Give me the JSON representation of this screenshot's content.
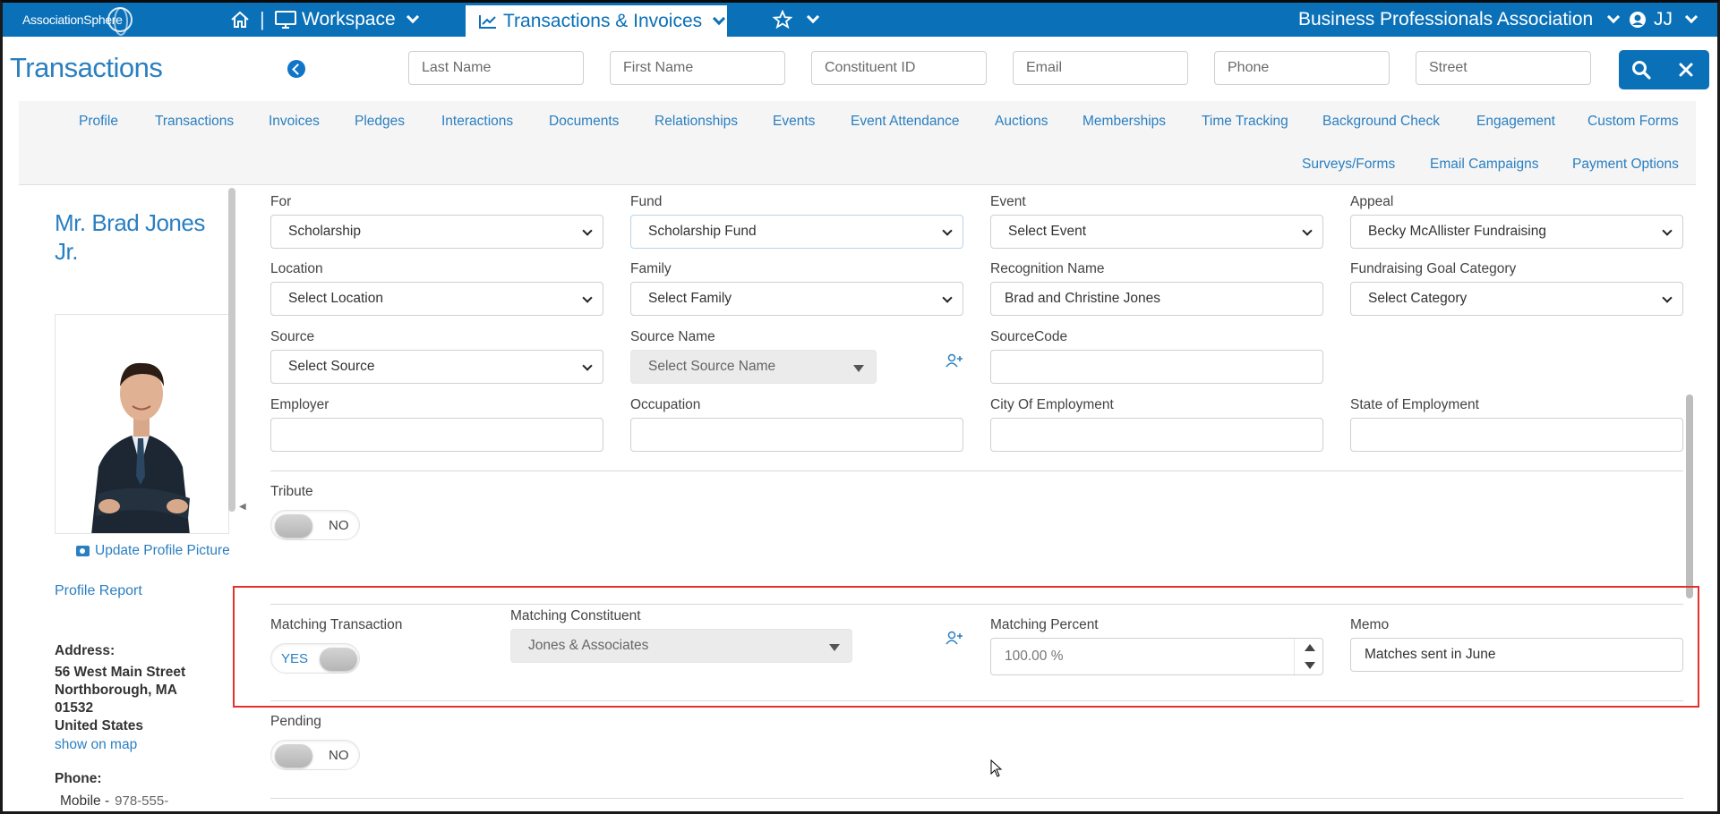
{
  "topbar": {
    "logo": "AssociationSphere",
    "separator": "|",
    "workspace": "Workspace",
    "active_tab": "Transactions & Invoices",
    "org": "Business Professionals Association",
    "user": "JJ",
    "colors": {
      "bar": "#0a70b8",
      "accent": "#2a7fc1",
      "highlight": "#e1322f"
    }
  },
  "header": {
    "title": "Transactions",
    "search": {
      "last_name": "Last Name",
      "first_name": "First Name",
      "constituent_id": "Constituent ID",
      "email": "Email",
      "phone": "Phone",
      "street": "Street"
    }
  },
  "nav": {
    "row1": [
      "Profile",
      "Transactions",
      "Invoices",
      "Pledges",
      "Interactions",
      "Documents",
      "Relationships",
      "Events",
      "Event Attendance",
      "Auctions",
      "Memberships",
      "Time Tracking",
      "Background Check",
      "Engagement",
      "Custom Forms"
    ],
    "row2": [
      "Surveys/Forms",
      "Email Campaigns",
      "Payment Options"
    ]
  },
  "profile": {
    "name": "Mr. Brad Jones Jr.",
    "update_picture": "Update Profile Picture",
    "profile_report": "Profile Report",
    "address_label": "Address:",
    "address_lines": [
      "56 West Main Street",
      "Northborough, MA",
      "01532",
      "United States"
    ],
    "show_on_map": "show on map",
    "phone_label": "Phone:",
    "mobile_label": "Mobile -",
    "mobile_number": "978-555-"
  },
  "form": {
    "for": {
      "label": "For",
      "value": "Scholarship"
    },
    "fund": {
      "label": "Fund",
      "value": "Scholarship Fund"
    },
    "event": {
      "label": "Event",
      "value": "Select Event"
    },
    "appeal": {
      "label": "Appeal",
      "value": "Becky McAllister Fundraising"
    },
    "location": {
      "label": "Location",
      "value": "Select Location"
    },
    "family": {
      "label": "Family",
      "value": "Select Family"
    },
    "recognition_name": {
      "label": "Recognition Name",
      "value": "Brad and Christine Jones"
    },
    "goal_category": {
      "label": "Fundraising Goal Category",
      "value": "Select Category"
    },
    "source": {
      "label": "Source",
      "value": "Select Source"
    },
    "source_name": {
      "label": "Source Name",
      "value": "Select Source Name"
    },
    "source_code": {
      "label": "SourceCode",
      "value": ""
    },
    "employer": {
      "label": "Employer",
      "value": ""
    },
    "occupation": {
      "label": "Occupation",
      "value": ""
    },
    "city_employment": {
      "label": "City Of Employment",
      "value": ""
    },
    "state_employment": {
      "label": "State of Employment",
      "value": ""
    },
    "tribute": {
      "label": "Tribute",
      "state": "NO"
    },
    "matching_transaction": {
      "label": "Matching Transaction",
      "state": "YES"
    },
    "matching_constituent": {
      "label": "Matching Constituent",
      "value": "Jones & Associates"
    },
    "matching_percent": {
      "label": "Matching Percent",
      "value": "100.00 %"
    },
    "memo": {
      "label": "Memo",
      "value": "Matches sent in June"
    },
    "pending": {
      "label": "Pending",
      "state": "NO"
    }
  }
}
